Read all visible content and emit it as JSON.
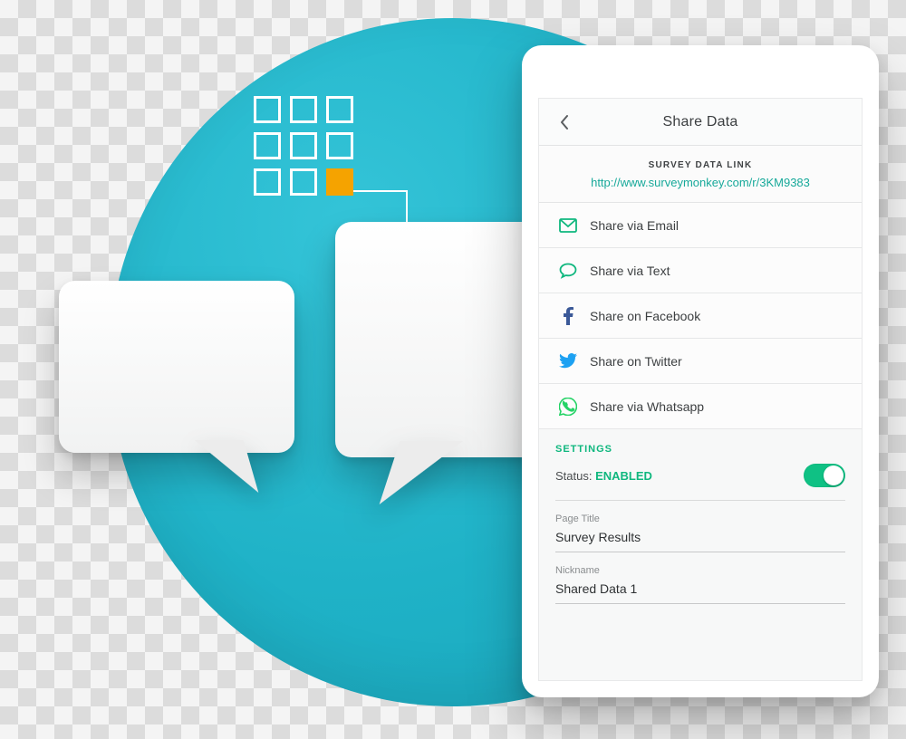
{
  "header": {
    "title": "Share Data"
  },
  "survey_link": {
    "caption": "SURVEY DATA LINK",
    "url": "http://www.surveymonkey.com/r/3KM9383"
  },
  "share_options": [
    {
      "icon": "email-icon",
      "label": "Share via Email"
    },
    {
      "icon": "text-icon",
      "label": "Share via Text"
    },
    {
      "icon": "facebook-icon",
      "label": "Share on Facebook"
    },
    {
      "icon": "twitter-icon",
      "label": "Share on Twitter"
    },
    {
      "icon": "whatsapp-icon",
      "label": "Share via Whatsapp"
    }
  ],
  "settings": {
    "section_label": "SETTINGS",
    "status_label": "Status: ",
    "status_value": "ENABLED",
    "toggle_on": true,
    "fields": [
      {
        "label": "Page Title",
        "value": "Survey Results"
      },
      {
        "label": "Nickname",
        "value": "Shared Data 1"
      }
    ]
  },
  "colors": {
    "accent_green": "#0fb77e",
    "link_teal": "#17a99a",
    "circle_teal": "#1fb2c7",
    "grid_amber": "#f5a300",
    "facebook_blue": "#3b5998",
    "twitter_blue": "#1da1f2",
    "whatsapp_green": "#25d366"
  }
}
